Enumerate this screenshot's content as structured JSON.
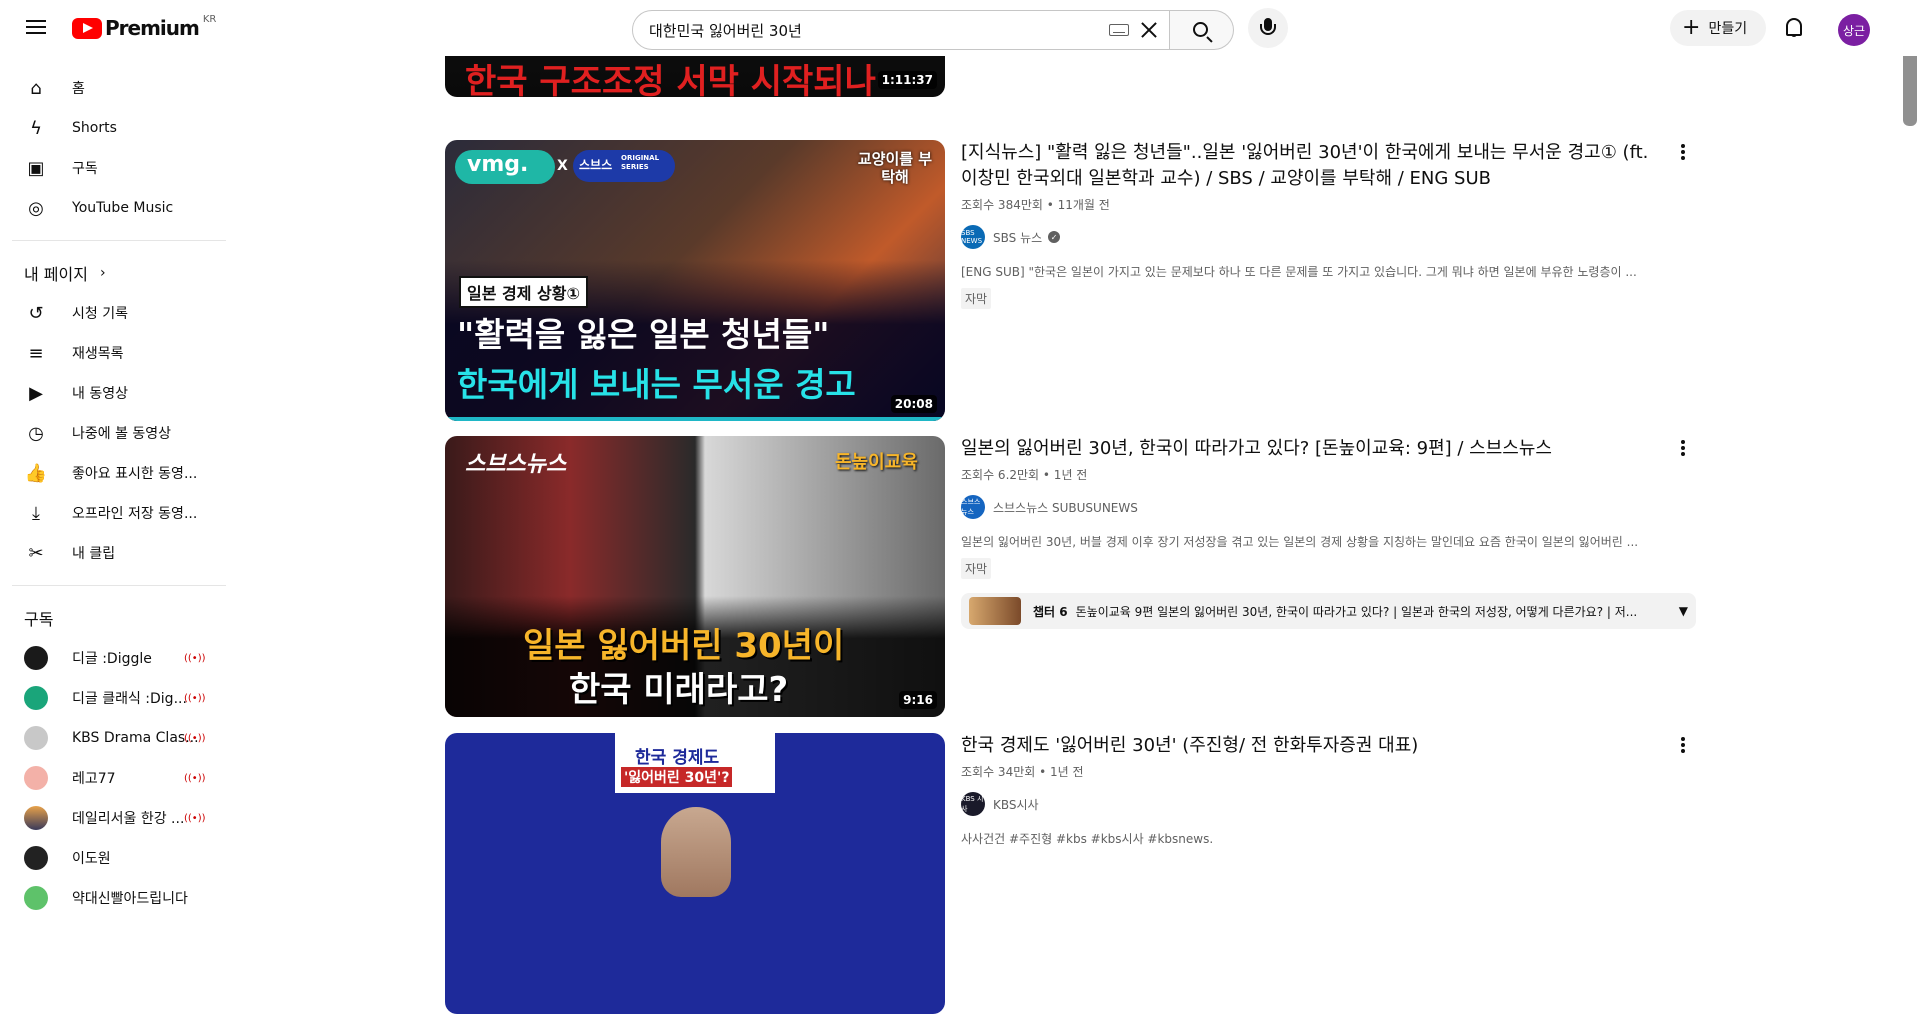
{
  "header": {
    "logo_text": "Premium",
    "country_code": "KR",
    "search_query": "대한민국 잃어버린 30년",
    "create_label": "만들기",
    "avatar_text": "상근"
  },
  "sidebar": {
    "main": [
      {
        "label": "홈",
        "icon": "home-icon"
      },
      {
        "label": "Shorts",
        "icon": "shorts-icon"
      },
      {
        "label": "구독",
        "icon": "subscriptions-icon"
      },
      {
        "label": "YouTube Music",
        "icon": "youtube-music-icon"
      }
    ],
    "you_header": "내 페이지",
    "you": [
      {
        "label": "시청 기록",
        "icon": "history-icon"
      },
      {
        "label": "재생목록",
        "icon": "playlists-icon"
      },
      {
        "label": "내 동영상",
        "icon": "your-videos-icon"
      },
      {
        "label": "나중에 볼 동영상",
        "icon": "watch-later-icon"
      },
      {
        "label": "좋아요 표시한 동영...",
        "icon": "liked-icon"
      },
      {
        "label": "오프라인 저장 동영...",
        "icon": "download-icon"
      },
      {
        "label": "내 클립",
        "icon": "clips-icon"
      }
    ],
    "subs_header": "구독",
    "subs": [
      {
        "label": "디글 :Diggle",
        "live": true,
        "color": "#1a1a1a"
      },
      {
        "label": "디글 클래식 :Dig...",
        "live": true,
        "color": "#1aa57a"
      },
      {
        "label": "KBS Drama Clas...",
        "live": true,
        "color": "#c8c8c8"
      },
      {
        "label": "레고77",
        "live": true,
        "color": "#f3b1a8"
      },
      {
        "label": "데일리서울 한강 ...",
        "live": true,
        "color": "#5a4a3a"
      },
      {
        "label": "이도원",
        "live": false,
        "color": "#222222"
      },
      {
        "label": "약대신빨아드립니다",
        "live": false,
        "color": "#5ec26a"
      }
    ]
  },
  "results": [
    {
      "duration": "1:11:37",
      "thumb_text": "한국 구조조정 서막 시작되나"
    },
    {
      "title": "[지식뉴스] \"활력 잃은 청년들\"..일본 '잃어버린 30년'이 한국에게 보내는 무서운 경고① (ft.이창민 한국외대 일본학과 교수) / SBS / 교양이를 부탁해 / ENG SUB",
      "meta": "조회수 384만회 • 11개월 전",
      "channel": "SBS 뉴스",
      "channel_av": "SBS NEWS",
      "desc": "[ENG SUB] \"한국은 일본이 가지고 있는 문제보다 하나 또 다른 문제를 또 가지고 있습니다. 그게 뭐냐 하면 일본에 부유한 노령층이 ...",
      "badge": "자막",
      "duration": "20:08",
      "thumb_tag": "vmg.",
      "thumb_x": "X",
      "thumb_brand": "스브스",
      "thumb_series": "ORIGINAL SERIES",
      "thumb_corner": "교양이를 부탁해",
      "thumb_label": "일본 경제 상황①",
      "thumb_line1": "\"활력을 잃은 일본 청년들\"",
      "thumb_line2": "한국에게 보내는 무서운 경고"
    },
    {
      "title": "일본의 잃어버린 30년, 한국이 따라가고 있다? [돈높이교육: 9편] / 스브스뉴스",
      "meta": "조회수 6.2만회 • 1년 전",
      "channel": "스브스뉴스 SUBUSUNEWS",
      "channel_av": "스브스 뉴스",
      "desc": "일본의 잃어버린 30년, 버블 경제 이후 장기 저성장을 겪고 있는 일본의 경제 상황을 지칭하는 말인데요 요즘 한국이 일본의 잃어버린 ...",
      "badge": "자막",
      "duration": "9:16",
      "thumb_tag": "스브스뉴스",
      "thumb_corner": "돈높이교육",
      "thumb_line1": "일본 잃어버린 30년이",
      "thumb_line2": "한국 미래라고?",
      "chapter_num": "챕터 6",
      "chapter_text": "돈높이교육 9편 일본의 잃어버린 30년, 한국이 따라가고 있다? | 일본과 한국의 저성장, 어떻게 다른가요? | 저..."
    },
    {
      "title": "한국 경제도 '잃어버린 30년' (주진형/ 전 한화투자증권 대표)",
      "meta": "조회수 34만회 • 1년 전",
      "channel": "KBS시사",
      "channel_av": "KBS 시사",
      "desc": "사사건건 #주진형 #kbs #kbs시사 #kbsnews.",
      "thumb_line1": "한국 경제도",
      "thumb_line2": "'잃어버린 30년'?"
    }
  ]
}
